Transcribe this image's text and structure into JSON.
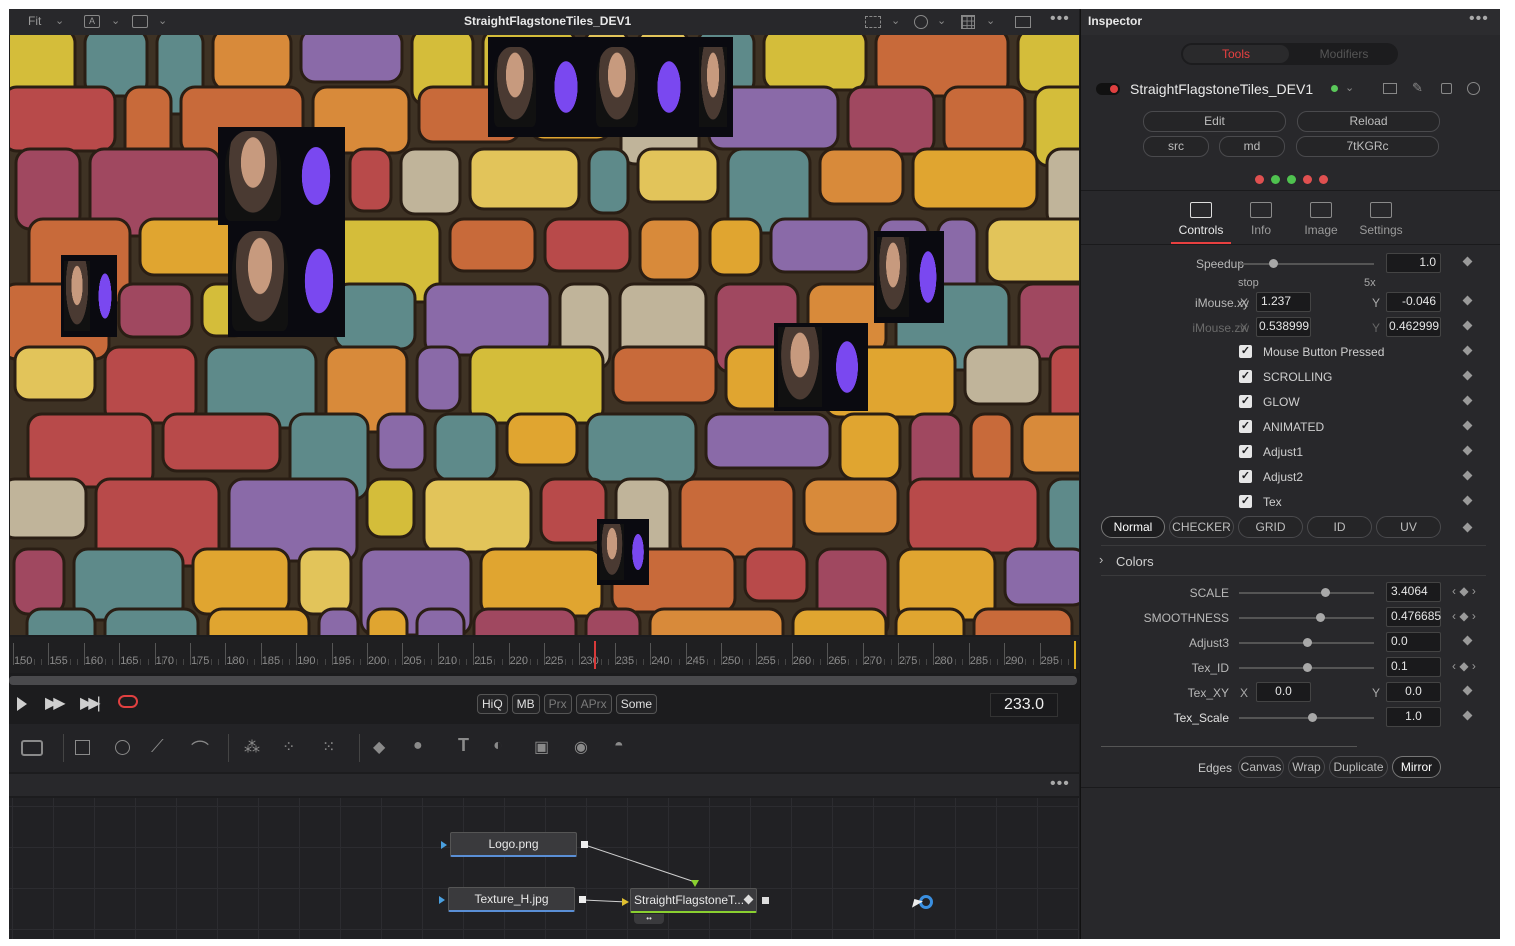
{
  "viewer": {
    "zoom": "Fit",
    "title": "StraightFlagstoneTiles_DEV1",
    "ruler_ticks": [
      "150",
      "155",
      "160",
      "165",
      "170",
      "175",
      "180",
      "185",
      "190",
      "195",
      "200",
      "205",
      "210",
      "215",
      "220",
      "225",
      "230",
      "235",
      "240",
      "245",
      "250",
      "255",
      "260",
      "265",
      "270",
      "275",
      "280",
      "285",
      "290",
      "295"
    ],
    "current_frame": "233.0",
    "quality_buttons": [
      "HiQ",
      "MB",
      "Prx",
      "APrx",
      "Some"
    ],
    "playhead_frame": 233
  },
  "nodes": [
    {
      "label": "Logo.png"
    },
    {
      "label": "Texture_H.jpg"
    },
    {
      "label": "StraightFlagstoneT..."
    }
  ],
  "inspector": {
    "title": "Inspector",
    "tabs": [
      "Tools",
      "Modifiers"
    ],
    "tool_name": "StraightFlagstoneTiles_DEV1",
    "buttons": {
      "edit": "Edit",
      "reload": "Reload",
      "src": "src",
      "md": "md",
      "code": "7tKGRc"
    },
    "dot_colors": [
      "#e05050",
      "#4fc24f",
      "#4fc24f",
      "#e05050",
      "#e05050"
    ],
    "sub_tabs": [
      "Controls",
      "Info",
      "Image",
      "Settings"
    ],
    "speedup": {
      "label": "Speedup",
      "value": "1.0",
      "min_label": "stop",
      "max_label": "5x",
      "level": 0.25
    },
    "imouse_xy": {
      "label": "iMouse.xy",
      "x_label": "X",
      "x": "1.237",
      "y_label": "Y",
      "y": "-0.046"
    },
    "imouse_zw": {
      "label": "iMouse.zw",
      "x_label": "X",
      "x": "0.538999",
      "y_label": "Y",
      "y": "0.462999"
    },
    "checkboxes": [
      "Mouse Button Pressed",
      "SCROLLING",
      "GLOW",
      "ANIMATED",
      "Adjust1",
      "Adjust2",
      "Tex"
    ],
    "modes": [
      "Normal",
      "CHECKER",
      "GRID",
      "ID",
      "UV"
    ],
    "colors_label": "Colors",
    "sliders": [
      {
        "label": "SCALE",
        "value": "3.4064",
        "level": 0.64
      },
      {
        "label": "SMOOTHNESS",
        "value": "0.476685",
        "level": 0.6
      },
      {
        "label": "Adjust3",
        "value": "0.0",
        "level": 0.5
      },
      {
        "label": "Tex_ID",
        "value": "0.1",
        "level": 0.5
      }
    ],
    "tex_xy": {
      "label": "Tex_XY",
      "x_label": "X",
      "x": "0.0",
      "y_label": "Y",
      "y": "0.0"
    },
    "tex_scale": {
      "label": "Tex_Scale",
      "value": "1.0",
      "level": 0.54
    },
    "edges": {
      "label": "Edges",
      "options": [
        "Canvas",
        "Wrap",
        "Duplicate",
        "Mirror"
      ],
      "selected": "Mirror"
    }
  }
}
